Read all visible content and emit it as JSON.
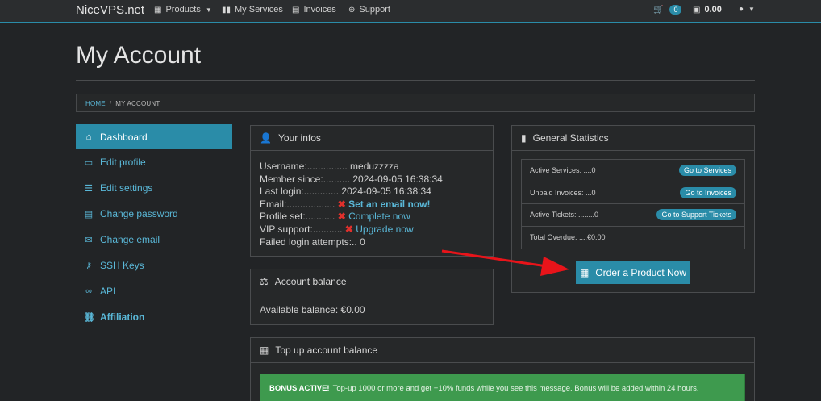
{
  "navbar": {
    "brand": "NiceVPS.net",
    "items": [
      {
        "label": "Products",
        "icon": "products-icon"
      },
      {
        "label": "My Services",
        "icon": "services-icon"
      },
      {
        "label": "Invoices",
        "icon": "invoices-icon"
      },
      {
        "label": "Support",
        "icon": "support-icon"
      }
    ],
    "cart_count": "0",
    "balance": "0.00"
  },
  "page": {
    "title": "My Account",
    "breadcrumb": [
      "HOME",
      "MY ACCOUNT"
    ]
  },
  "sidebar": {
    "items": [
      {
        "label": "Dashboard",
        "icon": "home-icon"
      },
      {
        "label": "Edit profile",
        "icon": "id-card-icon"
      },
      {
        "label": "Edit settings",
        "icon": "sliders-icon"
      },
      {
        "label": "Change password",
        "icon": "password-icon"
      },
      {
        "label": "Change email",
        "icon": "envelope-icon"
      },
      {
        "label": "SSH Keys",
        "icon": "key-icon"
      },
      {
        "label": "API",
        "icon": "api-icon"
      },
      {
        "label": "Affiliation",
        "icon": "affiliation-icon"
      }
    ]
  },
  "infos": {
    "title": "Your infos",
    "username_label": "Username:............... ",
    "username": "meduzzzza",
    "member_label": "Member since:.......... ",
    "member_since": "2024-09-05 16:38:34",
    "login_label": "Last login:............. ",
    "last_login": "2024-09-05 16:38:34",
    "email_label": "Email:.................. ",
    "email_action": "Set an email now!",
    "profile_label": "Profile set:........... ",
    "profile_action": "Complete now",
    "vip_label": "VIP support:........... ",
    "vip_action": "Upgrade now",
    "failed_label": "Failed login attempts:.. ",
    "failed_count": "0"
  },
  "balance_panel": {
    "title": "Account balance",
    "label": "Available balance: ",
    "value": "€0.00"
  },
  "stats": {
    "title": "General Statistics",
    "rows": [
      {
        "label": "Active Services: ....0",
        "button": "Go to Services"
      },
      {
        "label": "Unpaid Invoices: ...0",
        "button": "Go to Invoices"
      },
      {
        "label": "Active Tickets: ........0",
        "button": "Go to Support Tickets"
      },
      {
        "label": "Total Overdue: ....€0.00",
        "button": ""
      }
    ],
    "order_button": "Order a Product Now"
  },
  "topup": {
    "title": "Top up account balance",
    "alert_bold": "BONUS ACTIVE!",
    "alert_text": "Top-up 1000 or more and get +10% funds while you see this message. Bonus will be added within 24 hours."
  },
  "colors": {
    "accent": "#2a8ca8",
    "background": "#222426",
    "panel": "#262829",
    "error": "#e0302c",
    "success": "#3e9a4e",
    "arrow": "#e8141a"
  }
}
